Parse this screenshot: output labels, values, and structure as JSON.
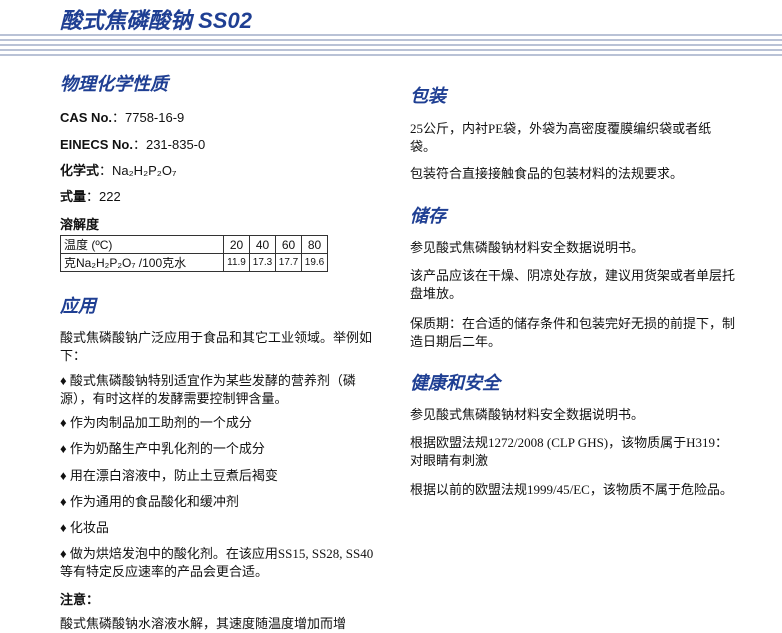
{
  "title": "酸式焦磷酸钠 SS02",
  "left": {
    "physchem_heading": "物理化学性质",
    "cas_label": "CAS No.",
    "cas_value": "：7758-16-9",
    "einecs_label": "EINECS No.",
    "einecs_value": "：231-835-0",
    "formula_label": "化学式",
    "formula_value": "：Na₂H₂P₂O₇",
    "mw_label": "式量",
    "mw_value": "：222",
    "solubility_heading": "溶解度",
    "solubility_table": {
      "temp_label": "温度 (ºC)",
      "temps": [
        "20",
        "40",
        "60",
        "80"
      ],
      "grams_label": "克Na₂H₂P₂O₇ /100克水",
      "values": [
        "11.9",
        "17.3",
        "17.7",
        "19.6"
      ]
    },
    "application_heading": "应用",
    "application_intro": "酸式焦磷酸钠广泛应用于食品和其它工业领域。举例如下：",
    "application_items": [
      "♦ 酸式焦磷酸钠特别适宜作为某些发酵的营养剂（磷源），有时这样的发酵需要控制钾含量。",
      "♦ 作为肉制品加工助剂的一个成分",
      "♦ 作为奶酪生产中乳化剂的一个成分",
      "♦ 用在漂白溶液中，防止土豆煮后褐变",
      "♦ 作为通用的食品酸化和缓冲剂",
      "♦ 化妆品",
      "♦ 做为烘焙发泡中的酸化剂。在该应用SS15, SS28, SS40等有特定反应速率的产品会更合适。"
    ],
    "note_label": "注意：",
    "note_text": "酸式焦磷酸钠水溶液水解，其速度随温度增加而增"
  },
  "right": {
    "packaging_heading": "包装",
    "packaging_p1": "25公斤，内衬PE袋，外袋为高密度覆膜编织袋或者纸袋。",
    "packaging_p2": "包装符合直接接触食品的包装材料的法规要求。",
    "storage_heading": "储存",
    "storage_p1": "参见酸式焦磷酸钠材料安全数据说明书。",
    "storage_p2": "该产品应该在干燥、阴凉处存放，建议用货架或者单层托盘堆放。",
    "storage_p3": "保质期：在合适的储存条件和包装完好无损的前提下，制造日期后二年。",
    "health_heading": "健康和安全",
    "health_p1": "参见酸式焦磷酸钠材料安全数据说明书。",
    "health_p2": "根据欧盟法规1272/2008 (CLP GHS)，该物质属于H319：对眼睛有刺激",
    "health_p3": "根据以前的欧盟法规1999/45/EC，该物质不属于危险品。"
  },
  "colors": {
    "heading": "#1f3f93",
    "stripe": "#b9c2d6"
  }
}
